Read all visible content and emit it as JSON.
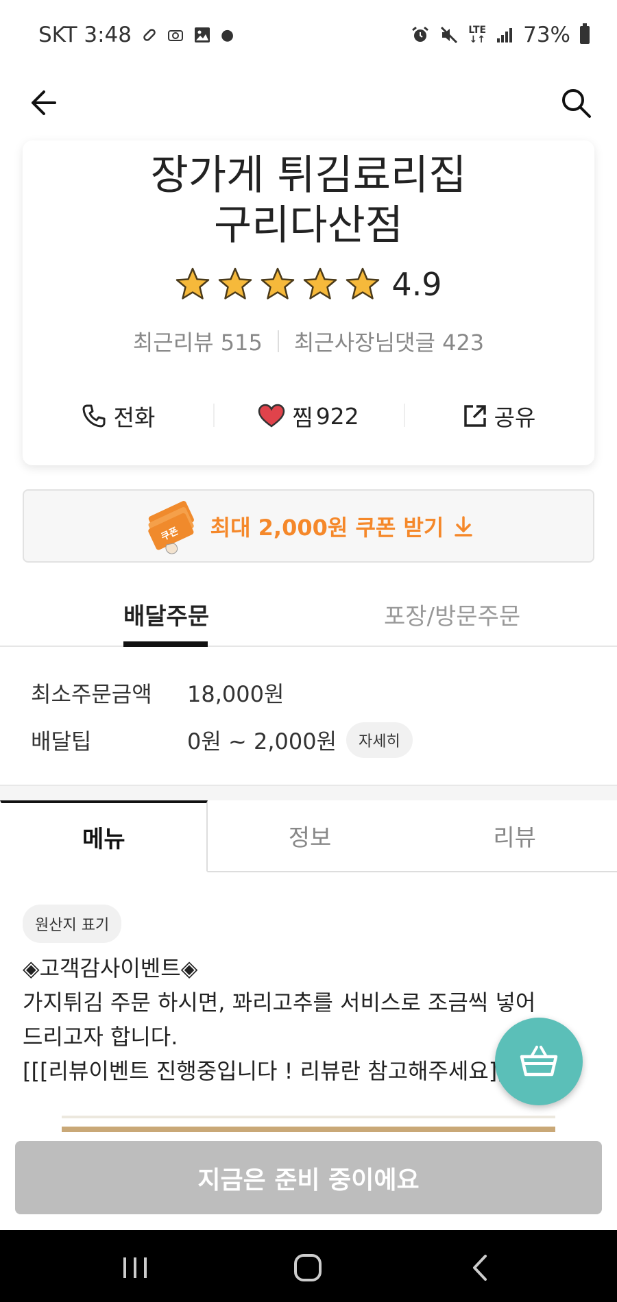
{
  "status_bar": {
    "carrier_time": "SKT 3:48",
    "network": "LTE",
    "battery": "73%",
    "icons": [
      "pill-icon",
      "camera-icon",
      "image-icon",
      "dot-icon",
      "alarm-icon",
      "mute-icon",
      "signal-icon",
      "battery-icon"
    ]
  },
  "header": {
    "back_icon": "arrow-left-icon",
    "search_icon": "search-icon"
  },
  "store": {
    "name_line1": "장가게 튀김료리집",
    "name_line2": "구리다산점",
    "rating": "4.9",
    "stars": 5,
    "recent_reviews": "최근리뷰 515",
    "recent_owner_comments": "최근사장님댓글 423",
    "actions": {
      "call": "전화",
      "like": "찜",
      "like_count": "922",
      "share": "공유"
    }
  },
  "coupon": {
    "label": "최대 2,000원 쿠폰 받기",
    "image_text": "쿠폰"
  },
  "order_tabs": {
    "delivery": "배달주문",
    "pickup": "포장/방문주문"
  },
  "delivery_info": {
    "min_order_label": "최소주문금액",
    "min_order_value": "18,000원",
    "tip_label": "배달팁",
    "tip_value": "0원 ~ 2,000원",
    "detail_label": "자세히"
  },
  "content_tabs": {
    "menu": "메뉴",
    "info": "정보",
    "review": "리뷰"
  },
  "origin_label": "원산지 표기",
  "notice": {
    "line1": "◈고객감사이벤트◈",
    "line2": "가지튀김 주문 하시면, 꽈리고추를 서비스로 조금씩 넣어",
    "line3": "드리고자 합니다.",
    "line4": "[[[리뷰이벤트 진행중입니다 ! 리뷰란 참고해주세요]]]"
  },
  "order_button": "지금은 준비 중이에요",
  "colors": {
    "accent_orange": "#f5882a",
    "cart_teal": "#5bbfb8",
    "disabled_gray": "#bdbdbd",
    "heart_red": "#e0434b",
    "star_gold": "#f6b93b"
  }
}
